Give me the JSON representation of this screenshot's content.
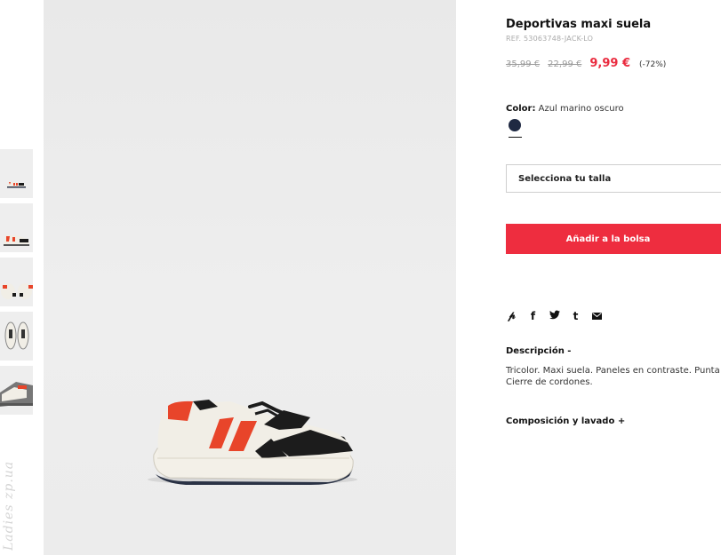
{
  "product": {
    "title": "Deportivas maxi suela",
    "ref": "REF. 53063748-JACK-LO",
    "prices": {
      "original": "35,99 €",
      "previous": "22,99 €",
      "current": "9,99 €",
      "discount": "(-72%)"
    },
    "color": {
      "label": "Color:",
      "value": "Azul marino oscuro",
      "swatch_hex": "#1f2942"
    },
    "size_select": "Selecciona tu talla",
    "add_to_bag": "Añadir a la bolsa",
    "share_icons": [
      "pinterest-icon",
      "facebook-icon",
      "twitter-icon",
      "tumblr-icon",
      "email-icon"
    ],
    "description": {
      "heading": "Descripción -",
      "line1": "Tricolor. Maxi suela. Paneles en contraste. Punta redo",
      "line2": "Cierre de cordones."
    },
    "composition": "Composición y lavado +"
  },
  "thumbnails_count": 5,
  "watermark": "Ladies zp.ua",
  "colors": {
    "accent": "#ee2d3f",
    "price": "#ea2a3e",
    "shoe_orange": "#e8452a",
    "shoe_black": "#1c1c1c",
    "shoe_white": "#f1eee6"
  }
}
